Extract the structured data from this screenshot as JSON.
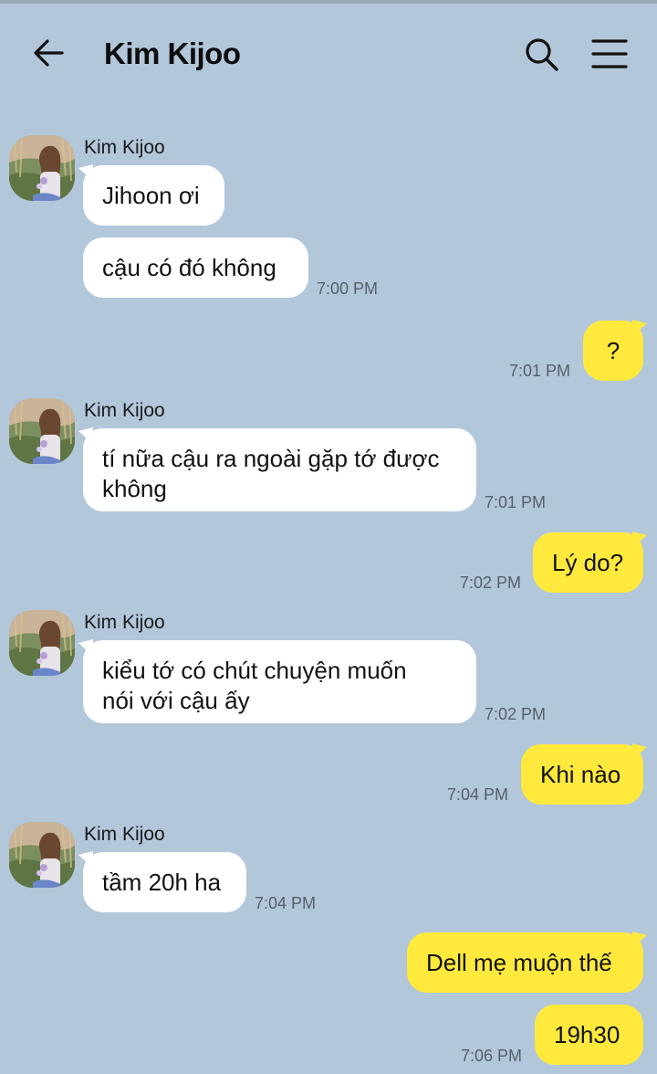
{
  "header": {
    "title": "Kim Kijoo",
    "icons": [
      "back-arrow-icon",
      "search-icon",
      "menu-icon"
    ]
  },
  "colors": {
    "background": "#b2c7da",
    "incoming_bubble": "#ffffff",
    "outgoing_bubble": "#fee93c",
    "timestamp": "#55606a"
  },
  "messages": {
    "g1": {
      "sender": "Kim Kijoo",
      "b1": "Jihoon ơi",
      "b2": "cậu có đó không",
      "time": "7:00 PM"
    },
    "o1": {
      "text": "?",
      "time": "7:01 PM"
    },
    "g2": {
      "sender": "Kim Kijoo",
      "b1_line1": "tí nữa cậu ra ngoài gặp tớ được",
      "b1_line2": "không",
      "time": "7:01 PM"
    },
    "o2": {
      "text": "Lý do?",
      "time": "7:02 PM"
    },
    "g3": {
      "sender": "Kim Kijoo",
      "b1_line1": "kiểu tớ có chút chuyện muốn",
      "b1_line2": "nói với cậu ấy",
      "time": "7:02 PM"
    },
    "o3": {
      "text": "Khi nào",
      "time": "7:04 PM"
    },
    "g4": {
      "sender": "Kim Kijoo",
      "b1": "tầm 20h ha",
      "time": "7:04 PM"
    },
    "o4": {
      "text": "Dell mẹ muộn thế"
    },
    "o5": {
      "text": "19h30",
      "time": "7:06 PM"
    }
  }
}
